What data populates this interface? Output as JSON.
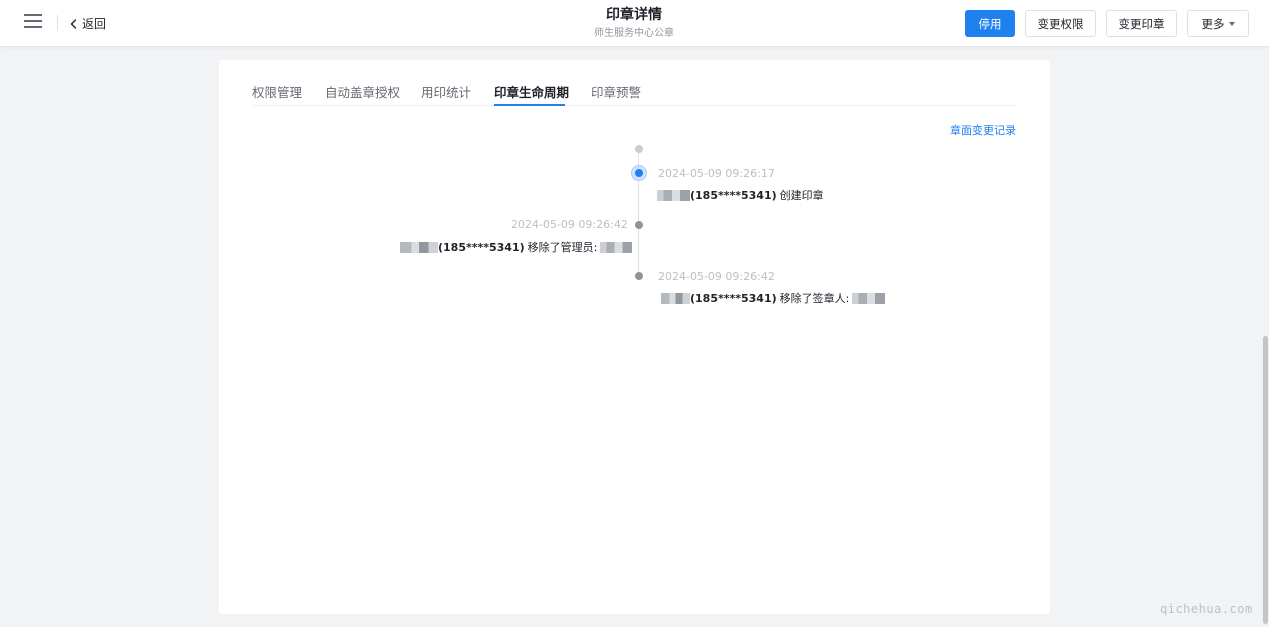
{
  "header": {
    "back_label": "返回",
    "title": "印章详情",
    "subtitle": "师生服务中心公章",
    "buttons": {
      "disable": "停用",
      "change_permission": "变更权限",
      "change_seal": "变更印章",
      "more": "更多"
    }
  },
  "tabs": [
    {
      "label": "权限管理"
    },
    {
      "label": "自动盖章授权"
    },
    {
      "label": "用印统计"
    },
    {
      "label": "印章生命周期",
      "active": true
    },
    {
      "label": "印章预警"
    }
  ],
  "change_record_link": "章面变更记录",
  "timeline": [
    {
      "time": "2024-05-09 09:26:17",
      "phone": "(185****5341)",
      "action": "创建印章",
      "side": "right",
      "dot": "active"
    },
    {
      "time": "2024-05-09 09:26:42",
      "phone": "(185****5341)",
      "action": "移除了管理员:",
      "side": "left",
      "dot": "normal"
    },
    {
      "time": "2024-05-09 09:26:42",
      "phone": "(185****5341)",
      "action": "移除了签章人:",
      "side": "right",
      "dot": "normal"
    }
  ],
  "watermark": "qichehua.com",
  "colors": {
    "primary": "#1f80f0",
    "background": "#f2f3f5",
    "text": "#1f2329",
    "muted": "#bbbfc4"
  },
  "icons": {
    "menu": "menu-icon",
    "back": "chevron-left-icon",
    "more": "caret-down-icon"
  }
}
